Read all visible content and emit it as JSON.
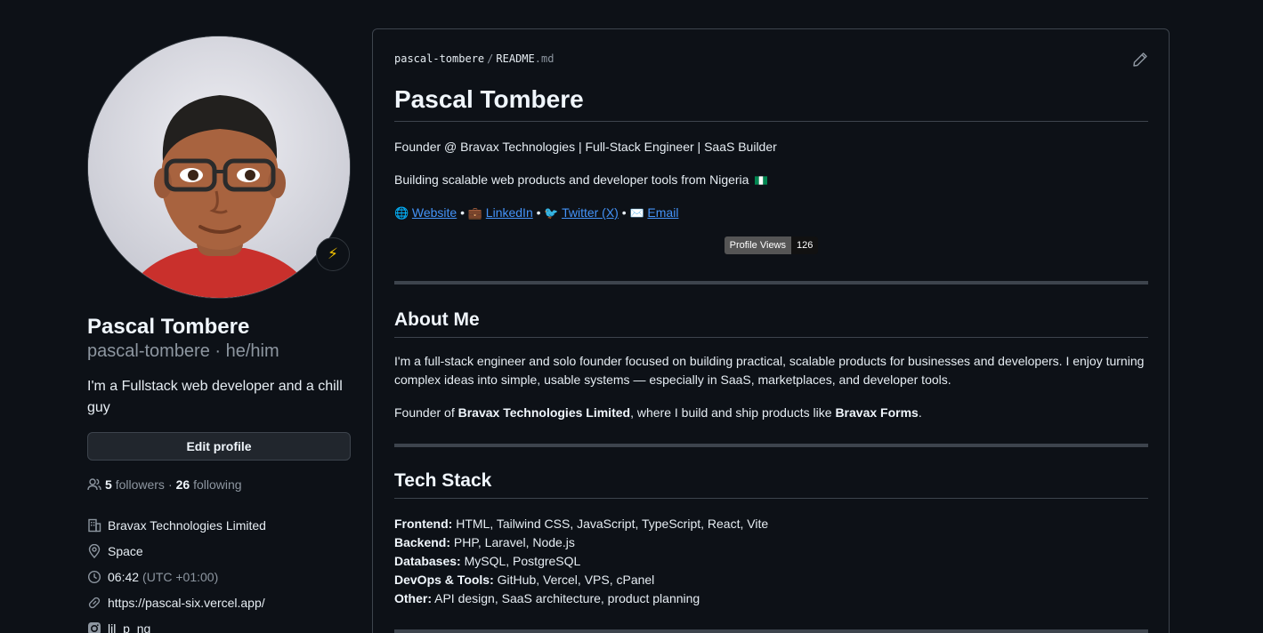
{
  "profile": {
    "full_name": "Pascal Tombere",
    "login": "pascal-tombere",
    "pronouns": "he/him",
    "login_line": "pascal-tombere · he/him",
    "status_emoji": "⚡",
    "bio": "I'm a Fullstack web developer and a chill guy",
    "edit_label": "Edit profile",
    "followers_count": "5",
    "followers_label": "followers",
    "following_count": "26",
    "following_label": "following",
    "company": "Bravax Technologies Limited",
    "location": "Space",
    "local_time": "06:42",
    "timezone": "(UTC +01:00)",
    "website": "https://pascal-six.vercel.app/",
    "instagram": "lil_p_ng"
  },
  "readme": {
    "crumb_user": "pascal-tombere",
    "crumb_sep": "/",
    "crumb_file": "README",
    "crumb_ext": ".md",
    "title": "Pascal Tombere",
    "tagline": "Founder @ Bravax Technologies | Full-Stack Engineer | SaaS Builder",
    "subline": "Building scalable web products and developer tools from Nigeria",
    "links": [
      {
        "emoji": "🌐",
        "label": "Website"
      },
      {
        "emoji": "💼",
        "label": "LinkedIn"
      },
      {
        "emoji": "🐦",
        "label": "Twitter (X)"
      },
      {
        "emoji": "✉️",
        "label": "Email"
      }
    ],
    "link_sep": "•",
    "badge_label": "Profile Views",
    "badge_value": "126",
    "about_heading": "About Me",
    "about_p1": "I'm a full-stack engineer and solo founder focused on building practical, scalable products for businesses and developers. I enjoy turning complex ideas into simple, usable systems — especially in SaaS, marketplaces, and developer tools.",
    "about_p2_pre": "Founder of ",
    "about_p2_company": "Bravax Technologies Limited",
    "about_p2_mid": ", where I build and ship products like ",
    "about_p2_product": "Bravax Forms",
    "about_p2_post": ".",
    "stack_heading": "Tech Stack",
    "stack": [
      {
        "label": "Frontend:",
        "value": "HTML, Tailwind CSS, JavaScript, TypeScript, React, Vite"
      },
      {
        "label": "Backend:",
        "value": "PHP, Laravel, Node.js"
      },
      {
        "label": "Databases:",
        "value": "MySQL, PostgreSQL"
      },
      {
        "label": "DevOps & Tools:",
        "value": "GitHub, Vercel, VPS, cPanel"
      },
      {
        "label": "Other:",
        "value": "API design, SaaS architecture, product planning"
      }
    ]
  },
  "icons": {
    "people": "people-icon",
    "org": "organization-icon",
    "location": "location-icon",
    "clock": "clock-icon",
    "link": "link-icon",
    "instagram": "instagram-icon",
    "pencil": "pencil-icon"
  },
  "colors": {
    "background": "#0d1117",
    "link": "#4493f8",
    "muted": "#8d96a0",
    "border": "#3d444d",
    "button": "#21262d"
  }
}
